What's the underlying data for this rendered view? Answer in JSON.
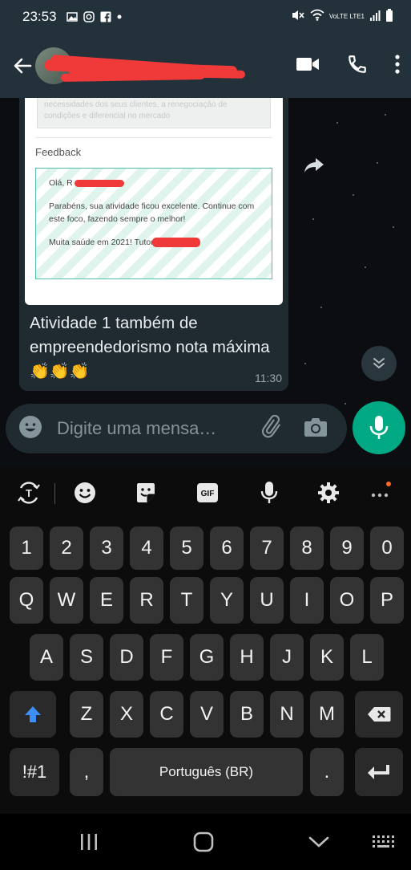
{
  "status_bar": {
    "time": "23:53",
    "network": "VoLTE LTE1"
  },
  "message": {
    "feedback_title": "Feedback",
    "blurred_text": "necessidades dos seus clientes, a renegociação de condições e diferencial no mercado",
    "greeting": "Olá, R",
    "body": "Parabéns, sua atividade ficou excelente. Continue com este foco, fazendo sempre o melhor!",
    "signoff": "Muita saúde em 2021! Tutor",
    "caption": "Atividade 1 também de empreendedorismo nota máxima",
    "emoji": "👏👏👏",
    "time": "11:30"
  },
  "composer": {
    "placeholder": "Digite uma mensa…"
  },
  "keyboard": {
    "row_numbers": [
      "1",
      "2",
      "3",
      "4",
      "5",
      "6",
      "7",
      "8",
      "9",
      "0"
    ],
    "row1": [
      "Q",
      "W",
      "E",
      "R",
      "T",
      "Y",
      "U",
      "I",
      "O",
      "P"
    ],
    "row2": [
      "A",
      "S",
      "D",
      "F",
      "G",
      "H",
      "J",
      "K",
      "L"
    ],
    "row3": [
      "Z",
      "X",
      "C",
      "V",
      "B",
      "N",
      "M"
    ],
    "symbols": "!#1",
    "comma": ",",
    "space": "Português (BR)",
    "period": ".",
    "gif": "GIF"
  },
  "colors": {
    "header_bg": "#22313a",
    "bubble_bg": "#202b31",
    "accent_green": "#00a884",
    "redaction": "#f03a3a",
    "feedback_border": "#52c0a6"
  }
}
